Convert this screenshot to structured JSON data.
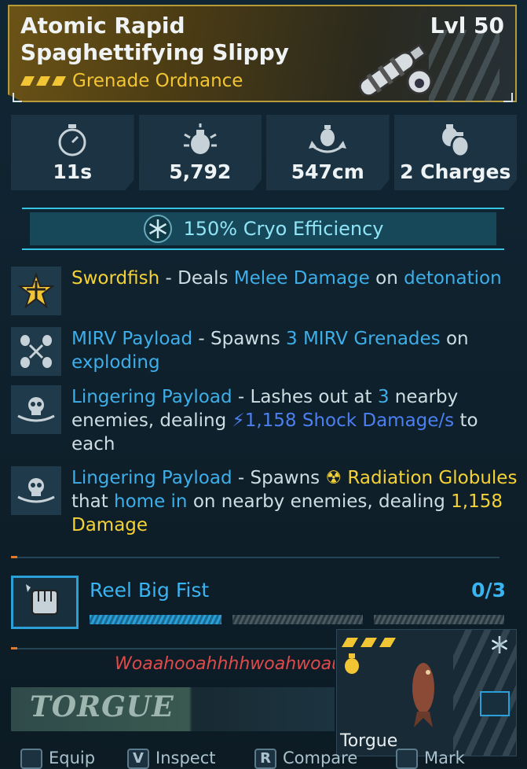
{
  "item": {
    "title": "Atomic Rapid Spaghettifying Slippy",
    "level": "Lvl 50",
    "type": "Grenade Ordnance"
  },
  "stats": [
    {
      "icon": "stopwatch-icon",
      "value": "11s"
    },
    {
      "icon": "grenade-damage-icon",
      "value": "5,792"
    },
    {
      "icon": "grenade-radius-icon",
      "value": "547cm"
    },
    {
      "icon": "grenade-charges-icon",
      "value": "2 Charges"
    }
  ],
  "cryo": {
    "text": "150% Cryo Efficiency"
  },
  "perks": [
    {
      "icon": "swordfish-star-icon",
      "parts": [
        {
          "t": "Swordfish",
          "c": "y"
        },
        {
          "t": " - Deals ",
          "c": ""
        },
        {
          "t": "Melee Damage",
          "c": "b"
        },
        {
          "t": " on ",
          "c": ""
        },
        {
          "t": "detonation",
          "c": "b"
        }
      ]
    },
    {
      "icon": "mirv-payload-icon",
      "parts": [
        {
          "t": "MIRV Payload",
          "c": "b"
        },
        {
          "t": " - Spawns ",
          "c": ""
        },
        {
          "t": "3 MIRV Grenades",
          "c": "b"
        },
        {
          "t": " on ",
          "c": ""
        },
        {
          "t": "exploding",
          "c": "b"
        }
      ]
    },
    {
      "icon": "skull-payload-icon",
      "parts": [
        {
          "t": "Lingering Payload",
          "c": "b"
        },
        {
          "t": " - Lashes out at ",
          "c": ""
        },
        {
          "t": "3",
          "c": "b"
        },
        {
          "t": " nearby enemies, dealing ",
          "c": ""
        },
        {
          "t": "⚡1,158 Shock Damage/s",
          "c": "dk"
        },
        {
          "t": " to each",
          "c": ""
        }
      ]
    },
    {
      "icon": "skull-payload-icon",
      "parts": [
        {
          "t": "Lingering Payload",
          "c": "b"
        },
        {
          "t": " - Spawns ",
          "c": ""
        },
        {
          "t": "☢ Radiation Globules",
          "c": "y"
        },
        {
          "t": " that ",
          "c": ""
        },
        {
          "t": "home in",
          "c": "b"
        },
        {
          "t": " on nearby enemies, dealing ",
          "c": ""
        },
        {
          "t": "1,158 Damage",
          "c": "y"
        }
      ]
    }
  ],
  "mod": {
    "name": "Reel Big Fist",
    "count": "0/3",
    "progress": [
      1,
      0,
      0
    ]
  },
  "flavor": "Woaahooahhhhwoahwoau",
  "brand": "TORGUE",
  "card": {
    "name": "Torgue"
  },
  "footer": [
    {
      "key": "",
      "label": "Equip"
    },
    {
      "key": "V",
      "label": "Inspect"
    },
    {
      "key": "R",
      "label": "Compare"
    },
    {
      "key": "",
      "label": "Mark"
    }
  ],
  "colors": {
    "accent_blue": "#3ab4f0",
    "accent_yellow": "#f4d236",
    "cryo": "#8fe4f5"
  }
}
